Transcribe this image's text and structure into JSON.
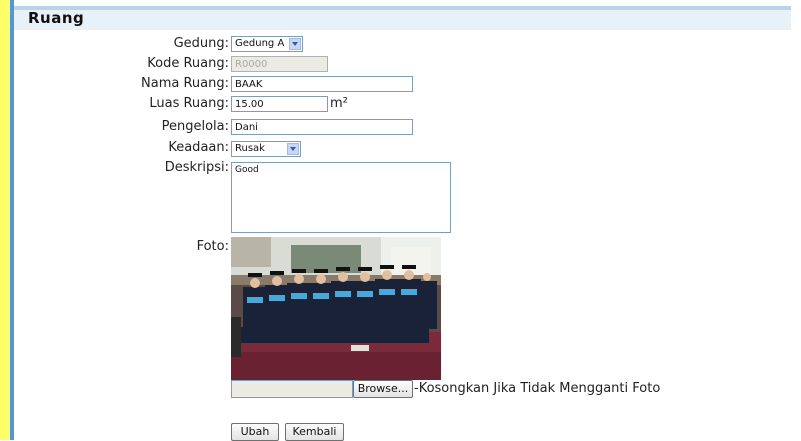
{
  "page": {
    "title": "Ruang"
  },
  "form": {
    "gedung": {
      "label": "Gedung:",
      "value": "Gedung A"
    },
    "kode": {
      "label": "Kode Ruang:",
      "value": "R0000"
    },
    "nama": {
      "label": "Nama Ruang:",
      "value": "BAAK"
    },
    "luas": {
      "label": "Luas Ruang:",
      "value": "15.00",
      "unit": "m²"
    },
    "pengelola": {
      "label": "Pengelola:",
      "value": "Dani"
    },
    "keadaan": {
      "label": "Keadaan:",
      "value": "Rusak"
    },
    "deskripsi": {
      "label": "Deskripsi:",
      "value": "Good"
    },
    "foto": {
      "label": "Foto:",
      "browse_label": "Browse...",
      "hint": "-Kosongkan Jika Tidak Mengganti Foto"
    }
  },
  "actions": {
    "ubah": "Ubah",
    "kembali": "Kembali"
  },
  "colors": {
    "accent": "#5599cc",
    "stripe": "#ffff66",
    "header_bg": "#e8f0f8"
  }
}
